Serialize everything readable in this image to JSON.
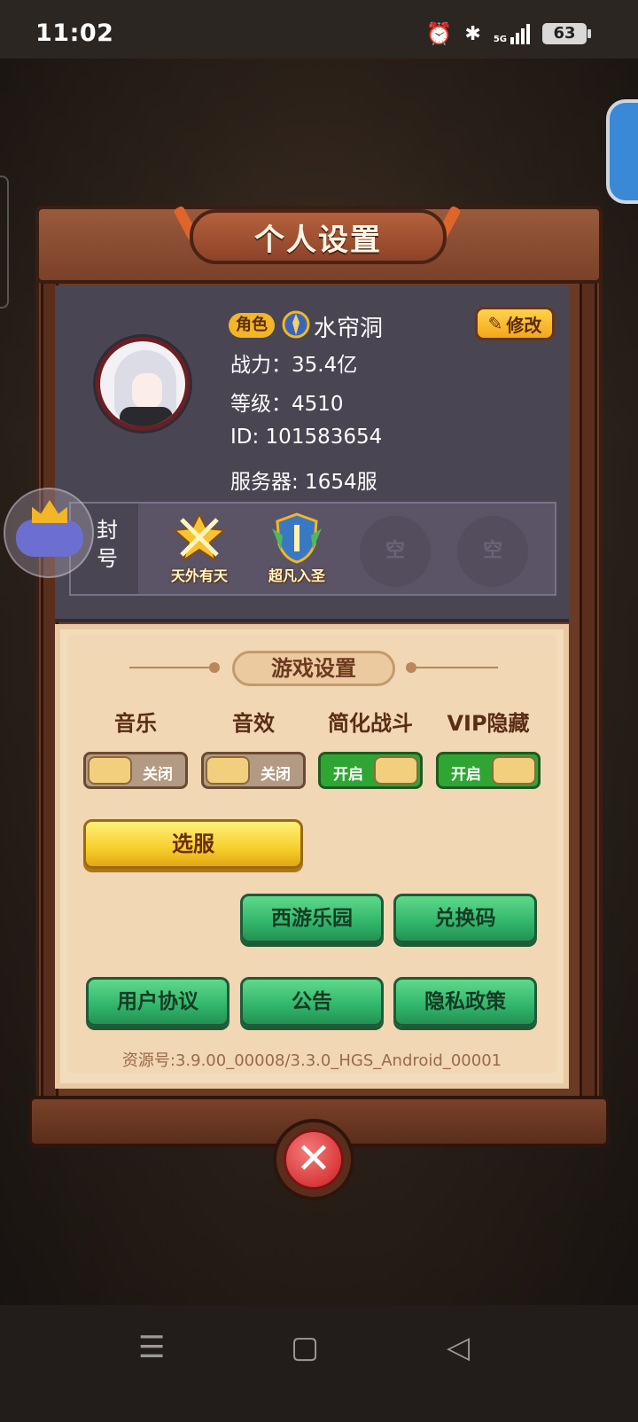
{
  "status": {
    "time": "11:02",
    "network": "5G",
    "battery": "63"
  },
  "panel": {
    "title": "个人设置",
    "role_badge": "角色",
    "role_name": "水帘洞",
    "edit_label": "修改",
    "combat_power": "战力：35.4亿",
    "level": "等级：4510",
    "id": "ID:  101583654",
    "server": "服务器:   1654服"
  },
  "titles": {
    "label": "封号",
    "items": [
      {
        "name": "天外有天"
      },
      {
        "name": "超凡入圣"
      }
    ],
    "empty_slot": "空"
  },
  "settings": {
    "section_title": "游戏设置",
    "options": [
      {
        "label": "音乐",
        "state": "关闭",
        "on": false
      },
      {
        "label": "音效",
        "state": "关闭",
        "on": false
      },
      {
        "label": "简化战斗",
        "state": "开启",
        "on": true
      },
      {
        "label": "VIP隐藏",
        "state": "开启",
        "on": true
      }
    ],
    "server_select": "选服",
    "buttons": {
      "park": "西游乐园",
      "redeem": "兑换码",
      "agreement": "用户协议",
      "notice": "公告",
      "privacy": "隐私政策"
    },
    "resource": "资源号:3.9.00_00008/3.3.0_HGS_Android_00001"
  },
  "icons": {
    "close": "close-icon",
    "edit": "edit-icon",
    "nav_menu": "menu-icon",
    "nav_home": "home-icon",
    "nav_back": "back-icon"
  },
  "colors": {
    "accent_green": "#30b56a",
    "accent_yellow": "#f6cf2b",
    "panel_wood": "#7a4129"
  }
}
